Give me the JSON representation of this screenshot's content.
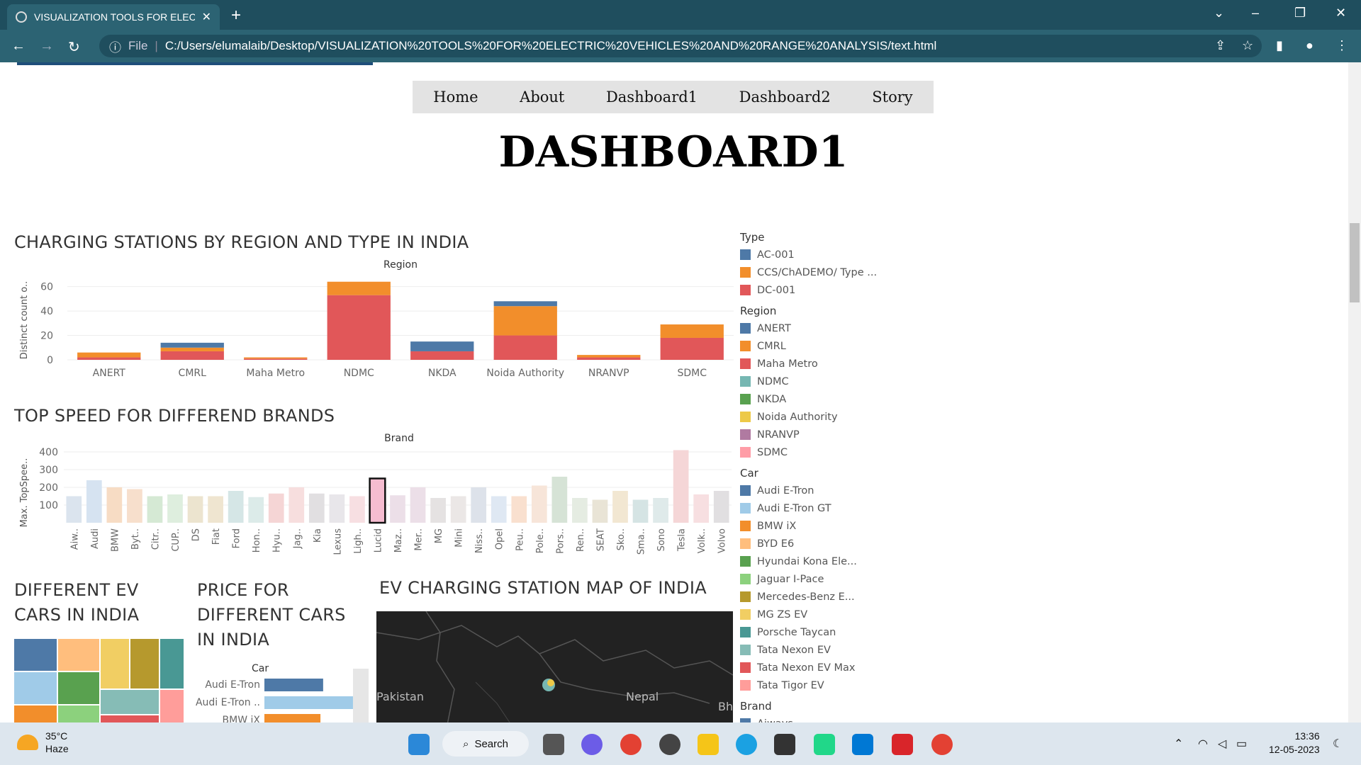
{
  "browser": {
    "tab_title": "VISUALIZATION TOOLS FOR ELEC",
    "tab_close": "✕",
    "new_tab": "+",
    "file_label": "File",
    "url": "C:/Users/elumalaib/Desktop/VISUALIZATION%20TOOLS%20FOR%20ELECTRIC%20VEHICLES%20AND%20RANGE%20ANALYSIS/text.html"
  },
  "nav": {
    "items": [
      "Home",
      "About",
      "Dashboard1",
      "Dashboard2",
      "Story"
    ]
  },
  "page_title": "DASHBOARD1",
  "sections": {
    "charging": "CHARGING STATIONS BY REGION AND TYPE IN INDIA",
    "topspeed": "TOP SPEED FOR DIFFEREND BRANDS",
    "evcars": "DIFFERENT EV CARS IN INDIA",
    "price": "PRICE FOR DIFFERENT CARS IN INDIA",
    "map": "EV CHARGING STATION MAP OF INDIA"
  },
  "chart_data": [
    {
      "type": "bar",
      "stacked": true,
      "title": "Region",
      "ylabel": "Distinct count o..",
      "yticks": [
        0,
        20,
        40,
        60
      ],
      "ylim": [
        0,
        65
      ],
      "categories": [
        "ANERT",
        "CMRL",
        "Maha Metro",
        "NDMC",
        "NKDA",
        "Noida Authority",
        "NRANVP",
        "SDMC"
      ],
      "series": [
        {
          "color": "#e15759",
          "values": [
            2,
            7,
            1,
            53,
            7,
            20,
            2,
            18
          ]
        },
        {
          "color": "#f28e2b",
          "values": [
            4,
            3,
            1,
            11,
            0,
            24,
            2,
            11
          ]
        },
        {
          "color": "#4e79a7",
          "values": [
            0,
            4,
            0,
            0,
            8,
            4,
            0,
            0
          ]
        }
      ]
    },
    {
      "type": "bar",
      "title": "Brand",
      "ylabel": "Max. TopSpee..",
      "yticks": [
        100,
        200,
        300,
        400
      ],
      "ylim": [
        0,
        420
      ],
      "categories": [
        "Aiw..",
        "Audi",
        "BMW",
        "Byt..",
        "Citr..",
        "CUP..",
        "DS",
        "Fiat",
        "Ford",
        "Hon..",
        "Hyu..",
        "Jag..",
        "Kia",
        "Lexus",
        "Ligh..",
        "Lucid",
        "Maz..",
        "Mer..",
        "MG",
        "Mini",
        "Niss..",
        "Opel",
        "Peu..",
        "Pole..",
        "Pors..",
        "Ren..",
        "SEAT",
        "Sko..",
        "Sma..",
        "Sono",
        "Tesla",
        "Volk..",
        "Volvo"
      ],
      "values": [
        150,
        240,
        200,
        190,
        150,
        160,
        150,
        150,
        180,
        145,
        165,
        200,
        165,
        160,
        150,
        250,
        155,
        200,
        140,
        150,
        200,
        150,
        150,
        210,
        260,
        140,
        130,
        180,
        130,
        140,
        410,
        160,
        180
      ],
      "colors": [
        "#dbe4ee",
        "#d6e3f1",
        "#f7dcc4",
        "#f7dfcc",
        "#d5e9d4",
        "#deeede",
        "#ece4cf",
        "#efe5d0",
        "#d5e6e6",
        "#dcebe9",
        "#f5d5d5",
        "#f7dede",
        "#e1dfe1",
        "#e8e6ea",
        "#f7dfe2",
        "#f5bcd0",
        "#ecdfe8",
        "#ecdfe8",
        "#e5e2e2",
        "#ebe7e6",
        "#dde2ea",
        "#dfe8f3",
        "#f9e0cf",
        "#f7e5d9",
        "#d6e3d6",
        "#e5ece2",
        "#e9e4d6",
        "#f2e7d2",
        "#d5e4e4",
        "#dfeaea",
        "#f5d6d7",
        "#f7dfe1",
        "#e1dfe1"
      ],
      "highlighted": "Lucid"
    },
    {
      "type": "bar",
      "orientation": "horizontal",
      "title": "Car",
      "categories": [
        "Audi E-Tron",
        "Audi E-Tron ..",
        "BMW iX"
      ],
      "values": [
        65,
        98,
        62
      ],
      "colors": [
        "#4e79a7",
        "#a0cbe8",
        "#f28e2b"
      ]
    }
  ],
  "treemap_colors": [
    "#4e79a7",
    "#ffbe7d",
    "#f1ce63",
    "#b6992d",
    "#499894",
    "#a0cbe8",
    "#59a14f",
    "#86bcb6",
    "#ff9d9a",
    "#f28e2b",
    "#8cd17d",
    "#e15759"
  ],
  "map": {
    "labels": [
      "Pakistan",
      "Nepal",
      "Bhu"
    ]
  },
  "legend": {
    "type_title": "Type",
    "type": [
      {
        "label": "AC-001",
        "color": "#4e79a7"
      },
      {
        "label": "CCS/ChADEMO/ Type ...",
        "color": "#f28e2b"
      },
      {
        "label": "DC-001",
        "color": "#e15759"
      }
    ],
    "region_title": "Region",
    "region": [
      {
        "label": "ANERT",
        "color": "#4e79a7"
      },
      {
        "label": "CMRL",
        "color": "#f28e2b"
      },
      {
        "label": "Maha Metro",
        "color": "#e15759"
      },
      {
        "label": "NDMC",
        "color": "#76b7b2"
      },
      {
        "label": "NKDA",
        "color": "#59a14f"
      },
      {
        "label": "Noida Authority",
        "color": "#edc948"
      },
      {
        "label": "NRANVP",
        "color": "#b07aa1"
      },
      {
        "label": "SDMC",
        "color": "#ff9da7"
      }
    ],
    "car_title": "Car",
    "car": [
      {
        "label": "Audi E-Tron",
        "color": "#4e79a7"
      },
      {
        "label": "Audi E-Tron GT",
        "color": "#a0cbe8"
      },
      {
        "label": "BMW iX",
        "color": "#f28e2b"
      },
      {
        "label": "BYD E6",
        "color": "#ffbe7d"
      },
      {
        "label": "Hyundai Kona Ele...",
        "color": "#59a14f"
      },
      {
        "label": "Jaguar I-Pace",
        "color": "#8cd17d"
      },
      {
        "label": "Mercedes-Benz E...",
        "color": "#b6992d"
      },
      {
        "label": "MG ZS EV",
        "color": "#f1ce63"
      },
      {
        "label": "Porsche Taycan",
        "color": "#499894"
      },
      {
        "label": "Tata Nexon EV",
        "color": "#86bcb6"
      },
      {
        "label": "Tata Nexon EV Max",
        "color": "#e15759"
      },
      {
        "label": "Tata Tigor EV",
        "color": "#ff9d9a"
      }
    ],
    "brand_title": "Brand",
    "brand": [
      {
        "label": "Aiways",
        "color": "#4e79a7"
      }
    ]
  },
  "taskbar": {
    "temp": "35°C",
    "weather": "Haze",
    "search": "Search",
    "time": "13:36",
    "date": "12-05-2023"
  }
}
